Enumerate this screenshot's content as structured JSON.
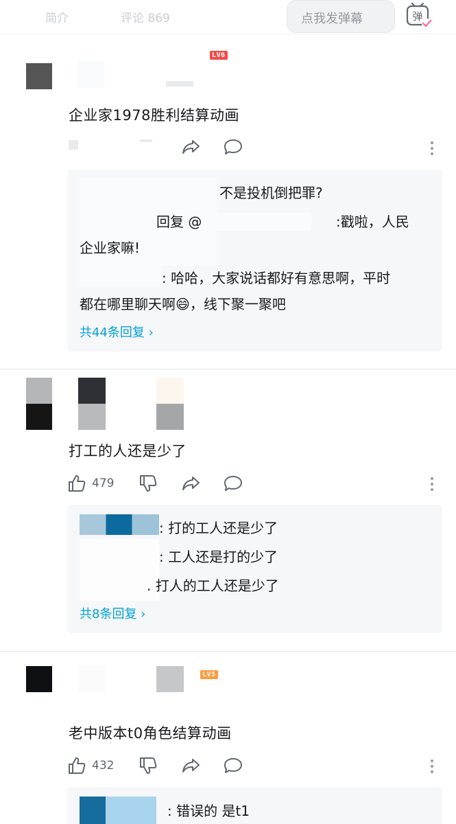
{
  "topbar": {
    "tab_jianjie": "简介",
    "tab_pinglun": "评论 869",
    "danmu_placeholder": "点我发弹幕",
    "danmu_icon": "弹"
  },
  "comments": [
    {
      "level": "LV6",
      "level_color": "#f04c49",
      "content": "企业家1978胜利结算动画",
      "replies": [
        "不是投机倒把罪?",
        "回复 @",
        ":戳啦，人民",
        "企业家嘛!",
        ": 哈哈，大家说话都好有意思啊，平时",
        "都在哪里聊天啊😄，线下聚一聚吧"
      ],
      "reply_link": "共44条回复 ›"
    },
    {
      "like_count": "479",
      "content": "打工的人还是少了",
      "replies": [
        ": 打的工人还是少了",
        ": 工人还是打的少了",
        ". 打人的工人还是少了"
      ],
      "reply_link": "共8条回复 ›"
    },
    {
      "level": "LV5",
      "level_color": "#ff9a3c",
      "like_count": "432",
      "content": "老中版本t0角色结算动画",
      "replies": [
        ": 错误的 是t1"
      ]
    }
  ],
  "icons": {
    "like": "thumbs-up-icon",
    "dislike": "thumbs-down-icon",
    "share": "share-icon",
    "reply": "comment-bubble-icon",
    "more": "more-vertical-icon"
  }
}
